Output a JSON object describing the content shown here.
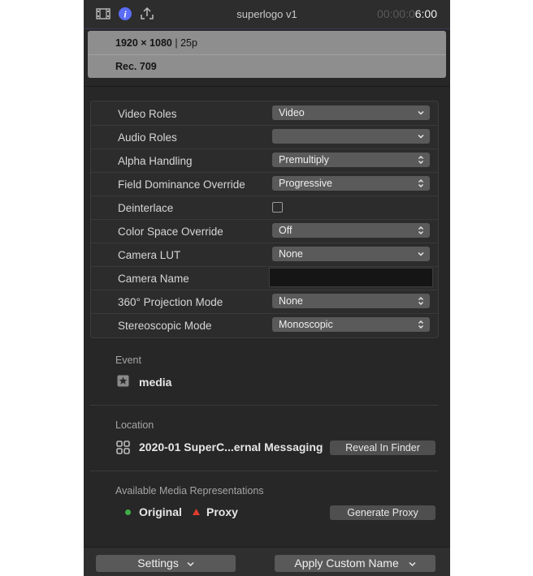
{
  "header": {
    "title": "superlogo v1",
    "timecode_dim": "00:00:0",
    "timecode_bright": "6:00"
  },
  "info": {
    "resolution": "1920 × 1080",
    "frame_rate": "| 25p",
    "color_space": "Rec. 709"
  },
  "properties": [
    {
      "label": "Video Roles",
      "value": "Video",
      "control": "dropdown"
    },
    {
      "label": "Audio Roles",
      "value": "",
      "control": "dropdown"
    },
    {
      "label": "Alpha Handling",
      "value": "Premultiply",
      "control": "popup"
    },
    {
      "label": "Field Dominance Override",
      "value": "Progressive",
      "control": "popup"
    },
    {
      "label": "Deinterlace",
      "value": "",
      "control": "checkbox"
    },
    {
      "label": "Color Space Override",
      "value": "Off",
      "control": "popup"
    },
    {
      "label": "Camera LUT",
      "value": "None",
      "control": "dropdown"
    },
    {
      "label": "Camera Name",
      "value": "",
      "control": "text"
    },
    {
      "label": "360° Projection Mode",
      "value": "None",
      "control": "popup"
    },
    {
      "label": "Stereoscopic Mode",
      "value": "Monoscopic",
      "control": "popup"
    }
  ],
  "event": {
    "section_label": "Event",
    "name": "media",
    "icon": "star-icon"
  },
  "location": {
    "section_label": "Location",
    "path": "2020-01 SuperC...ernal Messaging",
    "reveal_label": "Reveal In Finder",
    "icon": "library-icon"
  },
  "media_representations": {
    "section_label": "Available Media Representations",
    "original_label": "Original",
    "original_color": "#3fae49",
    "proxy_label": "Proxy",
    "proxy_color": "#e23b2e",
    "generate_label": "Generate Proxy"
  },
  "footer": {
    "settings_label": "Settings",
    "apply_label": "Apply Custom Name"
  },
  "colors": {
    "accent": "#6d7cff"
  }
}
